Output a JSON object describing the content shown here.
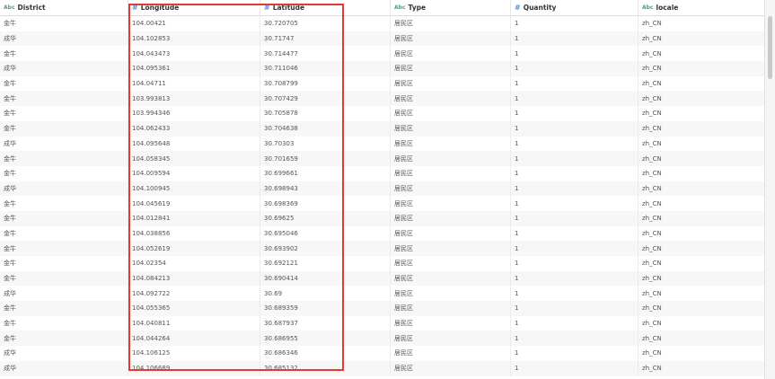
{
  "columns": [
    {
      "name": "District",
      "type_icon": "Abc"
    },
    {
      "name": "Longitude",
      "type_icon": "#"
    },
    {
      "name": "Latitude",
      "type_icon": "#"
    },
    {
      "name": "Type",
      "type_icon": "Abc"
    },
    {
      "name": "Quantity",
      "type_icon": "#"
    },
    {
      "name": "locale",
      "type_icon": "Abc"
    }
  ],
  "rows": [
    [
      "金牛",
      "104.00421",
      "30.720705",
      "居民区",
      "1",
      "zh_CN"
    ],
    [
      "成华",
      "104.102853",
      "30.71747",
      "居民区",
      "1",
      "zh_CN"
    ],
    [
      "金牛",
      "104.043473",
      "30.714477",
      "居民区",
      "1",
      "zh_CN"
    ],
    [
      "成华",
      "104.095361",
      "30.711046",
      "居民区",
      "1",
      "zh_CN"
    ],
    [
      "金牛",
      "104.04711",
      "30.708799",
      "居民区",
      "1",
      "zh_CN"
    ],
    [
      "金牛",
      "103.993813",
      "30.707429",
      "居民区",
      "1",
      "zh_CN"
    ],
    [
      "金牛",
      "103.994346",
      "30.705878",
      "居民区",
      "1",
      "zh_CN"
    ],
    [
      "金牛",
      "104.062433",
      "30.704638",
      "居民区",
      "1",
      "zh_CN"
    ],
    [
      "成华",
      "104.095648",
      "30.70303",
      "居民区",
      "1",
      "zh_CN"
    ],
    [
      "金牛",
      "104.058345",
      "30.701659",
      "居民区",
      "1",
      "zh_CN"
    ],
    [
      "金牛",
      "104.009594",
      "30.699661",
      "居民区",
      "1",
      "zh_CN"
    ],
    [
      "成华",
      "104.100945",
      "30.698943",
      "居民区",
      "1",
      "zh_CN"
    ],
    [
      "金牛",
      "104.045619",
      "30.698369",
      "居民区",
      "1",
      "zh_CN"
    ],
    [
      "金牛",
      "104.012841",
      "30.69625",
      "居民区",
      "1",
      "zh_CN"
    ],
    [
      "金牛",
      "104.038856",
      "30.695046",
      "居民区",
      "1",
      "zh_CN"
    ],
    [
      "金牛",
      "104.052619",
      "30.693902",
      "居民区",
      "1",
      "zh_CN"
    ],
    [
      "金牛",
      "104.02354",
      "30.692121",
      "居民区",
      "1",
      "zh_CN"
    ],
    [
      "金牛",
      "104.084213",
      "30.690414",
      "居民区",
      "1",
      "zh_CN"
    ],
    [
      "成华",
      "104.092722",
      "30.69",
      "居民区",
      "1",
      "zh_CN"
    ],
    [
      "金牛",
      "104.055365",
      "30.689359",
      "居民区",
      "1",
      "zh_CN"
    ],
    [
      "金牛",
      "104.040811",
      "30.687937",
      "居民区",
      "1",
      "zh_CN"
    ],
    [
      "金牛",
      "104.044264",
      "30.686955",
      "居民区",
      "1",
      "zh_CN"
    ],
    [
      "成华",
      "104.106125",
      "30.686346",
      "居民区",
      "1",
      "zh_CN"
    ],
    [
      "成华",
      "104.106689",
      "30.685132",
      "居民区",
      "1",
      "zh_CN"
    ]
  ],
  "colors": {
    "highlight_border": "#e53935",
    "text_icon": "#4a9d8f",
    "numeric_icon": "#5b8fd6"
  }
}
